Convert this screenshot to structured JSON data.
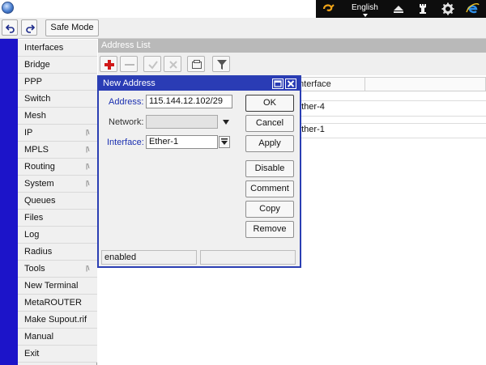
{
  "tray": {
    "language": "English",
    "icons": [
      "winbox-logo-icon",
      "eject-icon",
      "chess-rook-icon",
      "gear-icon",
      "internet-explorer-icon"
    ]
  },
  "toolbar": {
    "undo_icon": "undo-icon",
    "redo_icon": "redo-icon",
    "safe_mode_label": "Safe Mode"
  },
  "sidebar": {
    "items": [
      {
        "label": "Interfaces",
        "submenu": false
      },
      {
        "label": "Bridge",
        "submenu": false
      },
      {
        "label": "PPP",
        "submenu": false
      },
      {
        "label": "Switch",
        "submenu": false
      },
      {
        "label": "Mesh",
        "submenu": false
      },
      {
        "label": "IP",
        "submenu": true
      },
      {
        "label": "MPLS",
        "submenu": true
      },
      {
        "label": "Routing",
        "submenu": true
      },
      {
        "label": "System",
        "submenu": true
      },
      {
        "label": "Queues",
        "submenu": false
      },
      {
        "label": "Files",
        "submenu": false
      },
      {
        "label": "Log",
        "submenu": false
      },
      {
        "label": "Radius",
        "submenu": false
      },
      {
        "label": "Tools",
        "submenu": true
      },
      {
        "label": "New Terminal",
        "submenu": false
      },
      {
        "label": "MetaROUTER",
        "submenu": false
      },
      {
        "label": "Make Supout.rif",
        "submenu": false
      },
      {
        "label": "Manual",
        "submenu": false
      },
      {
        "label": "Exit",
        "submenu": false
      }
    ],
    "submenu_glyph": "|\\"
  },
  "address_list": {
    "title": "Address List",
    "toolbar_icons": [
      "add-icon",
      "remove-icon",
      "enable-icon",
      "disable-icon",
      "comment-icon",
      "filter-icon"
    ],
    "columns": {
      "interface": "Interface"
    },
    "rows": [
      {
        "interface": "ether-4"
      },
      {
        "interface": "ether-1"
      }
    ]
  },
  "dialog": {
    "title": "New Address",
    "address_label": "Address:",
    "address_value": "115.144.12.102/29",
    "network_label": "Network:",
    "network_value": "",
    "interface_label": "Interface:",
    "interface_value": "Ether-1",
    "buttons": {
      "ok": "OK",
      "cancel": "Cancel",
      "apply": "Apply",
      "disable": "Disable",
      "comment": "Comment",
      "copy": "Copy",
      "remove": "Remove"
    },
    "status": "enabled",
    "status_right": ""
  },
  "colors": {
    "nav_stripe": "#1c14c9",
    "dialog_title": "#2a3cb5",
    "label_blue": "#1a2fb0",
    "add_red": "#d01818"
  }
}
